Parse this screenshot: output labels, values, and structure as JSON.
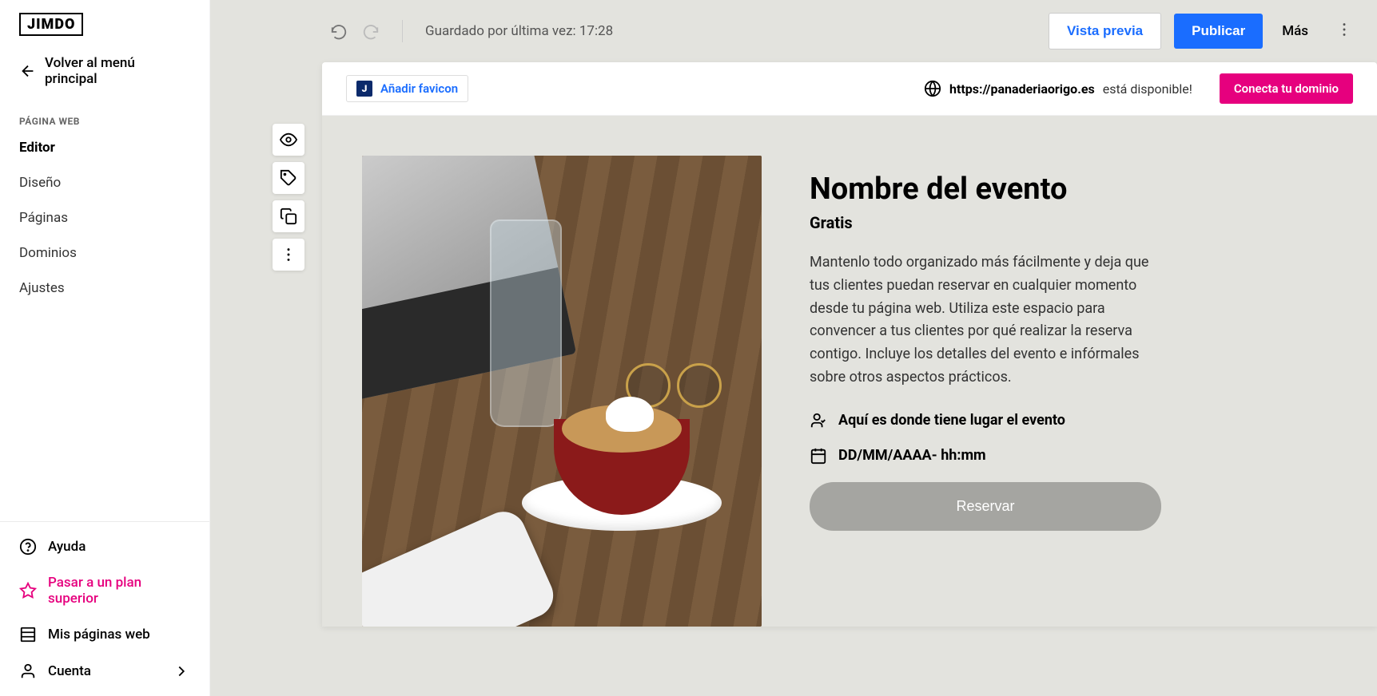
{
  "brand": "JIMDO",
  "back_link": "Volver al menú principal",
  "sidebar": {
    "section_label": "PÁGINA WEB",
    "items": [
      {
        "label": "Editor",
        "active": true
      },
      {
        "label": "Diseño",
        "active": false
      },
      {
        "label": "Páginas",
        "active": false
      },
      {
        "label": "Dominios",
        "active": false
      },
      {
        "label": "Ajustes",
        "active": false
      }
    ],
    "bottom": {
      "help": "Ayuda",
      "upgrade": "Pasar a un plan superior",
      "my_sites": "Mis páginas web",
      "account": "Cuenta"
    }
  },
  "topbar": {
    "saved_text": "Guardado por última vez: 17:28",
    "preview": "Vista previa",
    "publish": "Publicar",
    "more": "Más"
  },
  "favicon_bar": {
    "add_favicon": "Añadir favicon",
    "domain_url": "https://panaderiaorigo.es",
    "domain_available": "está disponible!",
    "connect": "Conecta tu dominio"
  },
  "event": {
    "title": "Nombre del evento",
    "price": "Gratis",
    "description": "Mantenlo todo organizado más fácilmente y deja que tus clientes puedan reservar en cualquier momento desde tu página web. Utiliza este espacio para convencer a tus clientes por qué realizar la reserva contigo. Incluye los detalles del evento e infórmales sobre otros aspectos prácticos.",
    "location": "Aquí es donde tiene lugar el evento",
    "datetime": "DD/MM/AAAA- hh:mm",
    "reserve": "Reservar"
  },
  "colors": {
    "primary": "#1a6dff",
    "accent": "#e6007e",
    "canvas": "#e3e3de"
  }
}
